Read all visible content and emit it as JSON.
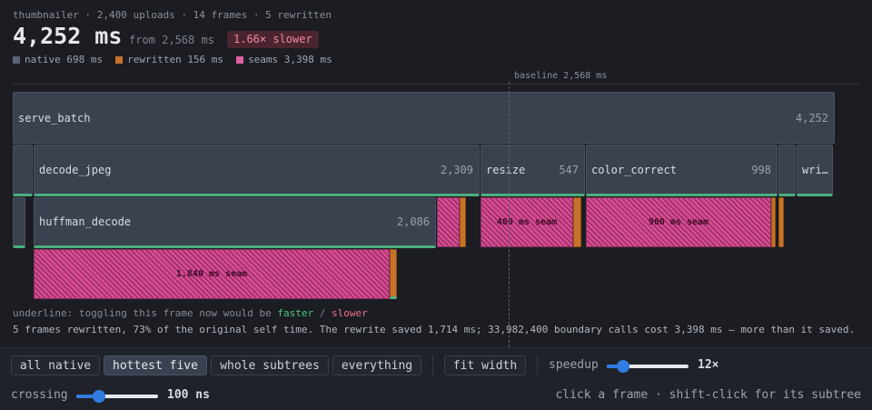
{
  "header": {
    "subtitle": "thumbnailer · 2,400 uploads · 14 frames · 5 rewritten",
    "total": "4,252 ms",
    "from": "from 2,568 ms",
    "badge": "1.66× slower",
    "legend": [
      {
        "label": "native 698 ms",
        "color": "#5a6372"
      },
      {
        "label": "rewritten 156 ms",
        "color": "#c7722a"
      },
      {
        "label": "seams 3,398 ms",
        "color": "#e0609f"
      }
    ]
  },
  "baseline": {
    "label": "baseline 2,568 ms"
  },
  "flame": {
    "serve_batch": {
      "name": "serve_batch",
      "value": "4,252"
    },
    "decode_jpeg": {
      "name": "decode_jpeg",
      "value": "2,309"
    },
    "resize": {
      "name": "resize",
      "value": "547"
    },
    "color_correct": {
      "name": "color_correct",
      "value": "998"
    },
    "write": {
      "name": "wri…"
    },
    "huffman_decode": {
      "name": "huffman_decode",
      "value": "2,086"
    },
    "seams": {
      "resize": "480 ms seam",
      "color_correct": "960 ms seam",
      "huffman": "1,840 ms seam"
    }
  },
  "notes": {
    "underline_prefix": "underline: toggling this frame now would be ",
    "faster": "faster",
    "slash": " / ",
    "slower": "slower",
    "summary": "5 frames rewritten, 73% of the original self time. The rewrite saved 1,714 ms; 33,982,400 boundary calls cost 3,398 ms — more than it saved."
  },
  "toolbar": {
    "presets": [
      "all native",
      "hottest five",
      "whole subtrees",
      "everything"
    ],
    "active_preset": "hottest five",
    "fit_width": "fit width",
    "speedup_label": "speedup",
    "speedup_value": "12×",
    "speedup_level": 0.2,
    "crossing_label": "crossing",
    "crossing_value": "100 ns",
    "crossing_level": 0.28,
    "hint": "click a frame · shift-click for its subtree"
  }
}
